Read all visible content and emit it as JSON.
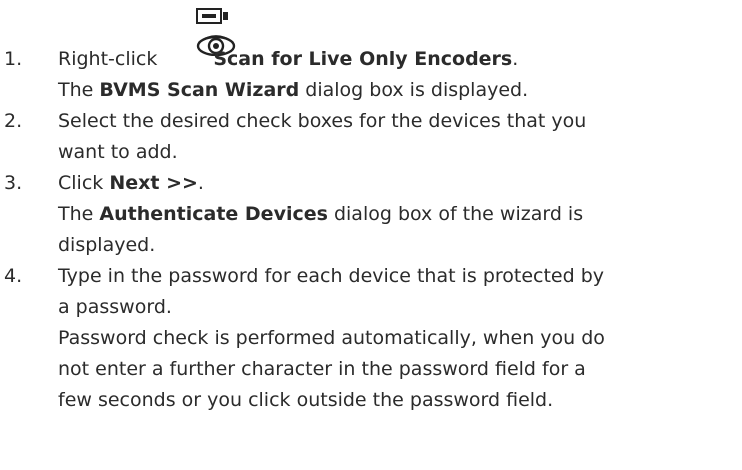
{
  "steps": [
    {
      "number": "1.",
      "lines": [
        {
          "before": "Right-click",
          "bold": "Scan for Live Only Encoders",
          "after": ".",
          "icon": "live-only-encoder-icon"
        },
        {
          "before": "The ",
          "bold": "BVMS Scan Wizard",
          "after": " dialog box is displayed."
        }
      ]
    },
    {
      "number": "2.",
      "lines": [
        {
          "text": "Select the desired check boxes for the devices that you"
        },
        {
          "text": "want to add."
        }
      ]
    },
    {
      "number": "3.",
      "lines": [
        {
          "before": "Click ",
          "bold": "Next >>",
          "after": "."
        },
        {
          "before": "The ",
          "bold": "Authenticate Devices",
          "after": " dialog box of the wizard is"
        },
        {
          "text": "displayed."
        }
      ]
    },
    {
      "number": "4.",
      "lines": [
        {
          "text": "Type in the password for each device that is protected by"
        },
        {
          "text": "a password."
        },
        {
          "text": "Password check is performed automatically, when you do"
        },
        {
          "text": "not enter a further character in the password field for a"
        },
        {
          "text": "few seconds or you click outside the password field."
        }
      ]
    }
  ]
}
